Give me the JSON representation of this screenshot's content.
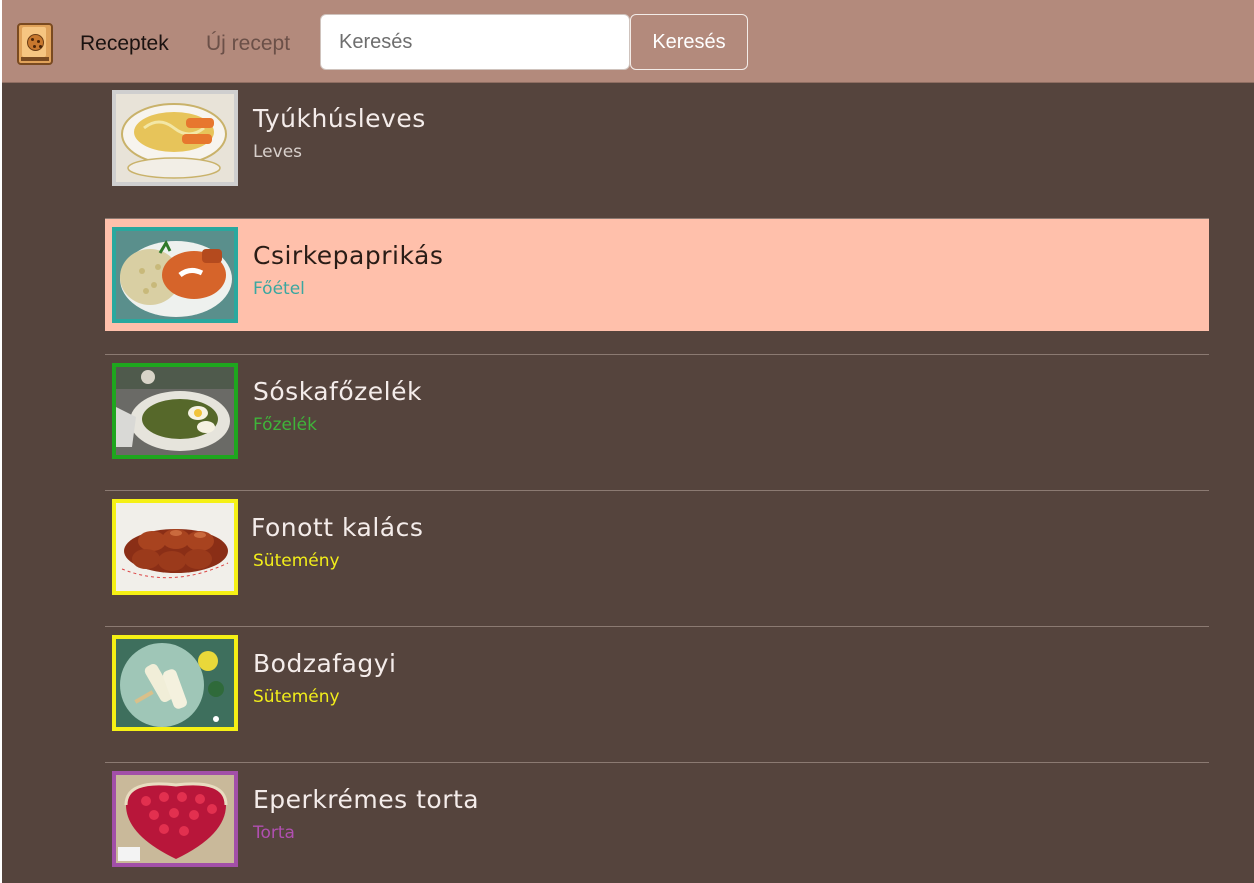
{
  "nav": {
    "home_label": "Receptek",
    "new_label": "Új recept",
    "brand_icon": "recipe-book-icon"
  },
  "search": {
    "placeholder": "Keresés",
    "value": "",
    "button_label": "Keresés"
  },
  "recipes": [
    {
      "title": "Tyúkhúsleves",
      "category": "Leves",
      "category_color": "#d8d0cc",
      "border_color": "#cfcfcf",
      "active": false
    },
    {
      "title": "Csirkepaprikás",
      "category": "Főétel",
      "category_color": "#3aa7a0",
      "border_color": "#2aa89e",
      "active": true
    },
    {
      "title": "Sóskafőzelék",
      "category": "Főzelék",
      "category_color": "#3fb53a",
      "border_color": "#1ea61e",
      "active": false
    },
    {
      "title": "Fonott kalács",
      "category": "Sütemény",
      "category_color": "#f2ee1a",
      "border_color": "#f5f015",
      "active": false
    },
    {
      "title": "Bodzafagyi",
      "category": "Sütemény",
      "category_color": "#f2ee1a",
      "border_color": "#f5f015",
      "active": false
    },
    {
      "title": "Eperkrémes torta",
      "category": "Torta",
      "category_color": "#b04fb0",
      "border_color": "#a24fa8",
      "active": false
    }
  ],
  "colors": {
    "navbar": "#b38a7c",
    "background": "#55443d",
    "active_row": "#ffc0ab"
  }
}
